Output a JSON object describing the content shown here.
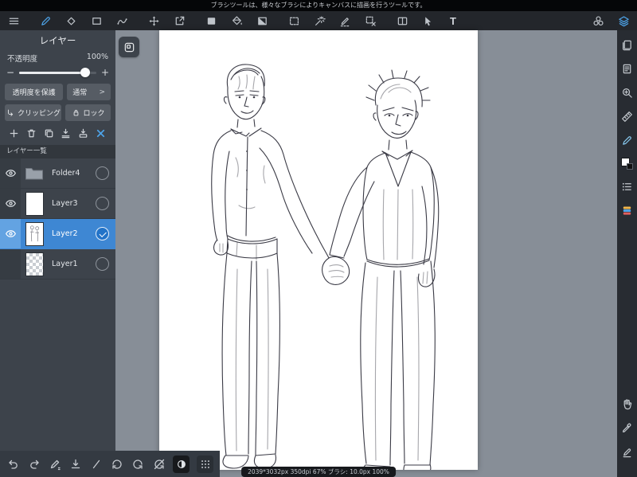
{
  "top_bar": {
    "message": "ブラシツールは、様々なブラシによりキャンバスに描画を行うツールです。"
  },
  "toolbar": {
    "text_tool": "T"
  },
  "layers_panel": {
    "title": "レイヤー",
    "opacity": {
      "label": "不透明度",
      "value": "100%",
      "minus": "−",
      "plus": "+"
    },
    "protect_button": "透明度を保護",
    "blend_button": "通常",
    "blend_chevron": ">",
    "clipping_button": "クリッピング",
    "lock_button": "ロック",
    "list_header": "レイヤー一覧",
    "layers": [
      {
        "name": "Folder4",
        "type": "folder",
        "visible": true,
        "selected": false
      },
      {
        "name": "Layer3",
        "type": "layer",
        "visible": true,
        "selected": false
      },
      {
        "name": "Layer2",
        "type": "layer",
        "visible": true,
        "selected": true
      },
      {
        "name": "Layer1",
        "type": "layer",
        "visible": false,
        "selected": false
      }
    ]
  },
  "status_bar": {
    "text": "2039*3032px 350dpi 67% ブラシ: 10.0px 100%"
  },
  "colors": {
    "accent_blue": "#4da3e8",
    "selected_row": "#3e87d3",
    "panel_bg": "#3d434b",
    "toolbar_bg": "#23262b",
    "canvas_area_bg": "#878e97"
  },
  "icon_names": [
    "menu-icon",
    "brush-tool-icon",
    "eraser-tool-icon",
    "shape-tool-icon",
    "scatter-tool-icon",
    "move-tool-icon",
    "export-icon",
    "fill-rect-icon",
    "bucket-icon",
    "gradient-icon",
    "marquee-select-icon",
    "magic-wand-icon",
    "lasso-pen-icon",
    "deselect-icon",
    "split-view-icon",
    "cursor-tool-icon",
    "text-tool-icon",
    "color-sync-icon",
    "layers-icon",
    "add-layer-icon",
    "delete-layer-icon",
    "duplicate-layer-icon",
    "merge-down-icon",
    "transfer-layer-icon",
    "close-panel-icon",
    "eye-icon",
    "folder-icon",
    "undo-icon",
    "redo-icon",
    "pen-settings-icon",
    "download-icon",
    "line-icon",
    "rotate-ccw-icon",
    "rotate-cw-icon",
    "rotate-reset-icon",
    "invert-icon",
    "grid-icon",
    "pages-panel-icon",
    "document-panel-icon",
    "zoom-panel-icon",
    "ruler-icon",
    "brush-panel-icon",
    "color-swatch",
    "list-panel-icon",
    "palette-panel-icon",
    "hand-tool-icon",
    "eyedropper-tool-icon",
    "stylus-icon",
    "collapse-panel-icon"
  ]
}
